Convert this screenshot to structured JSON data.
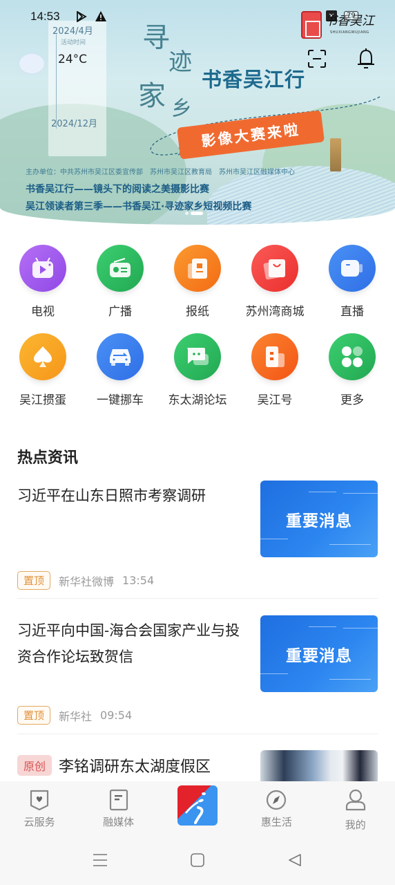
{
  "status_bar": {
    "time": "14:53",
    "icons": [
      "play-store-icon",
      "warning-icon"
    ],
    "battery": "79",
    "notification_badge": "×"
  },
  "banner": {
    "date_start": "2024/4月",
    "date_label": "活动时间",
    "temperature": "24°C",
    "date_end": "2024/12月",
    "calligraphy": [
      "寻",
      "迹",
      "家",
      "乡"
    ],
    "title": "书香吴江行",
    "tag": "影像大赛来啦",
    "organizer": "主办单位：中共苏州市吴江区委宣传部　苏州市吴江区教育局　苏州市吴江区融媒体中心",
    "subtitle_1": "书香吴江行——镜头下的阅读之美摄影比赛",
    "subtitle_2": "吴江领读者第三季——书香吴江·寻迹家乡短视频比赛",
    "logo_text": "书香吴江",
    "logo_sub": "SHUXIANGWUJIANG",
    "carousel_pages": 2,
    "carousel_active": 1
  },
  "grid": {
    "items": [
      {
        "label": "电视",
        "icon": "tv-icon",
        "color": "#a55ef0"
      },
      {
        "label": "广播",
        "icon": "radio-icon",
        "color": "#2fbb5f"
      },
      {
        "label": "报纸",
        "icon": "newspaper-icon",
        "color": "#f7821f"
      },
      {
        "label": "苏州湾商城",
        "icon": "shopping-bag-icon",
        "color": "#f2413f"
      },
      {
        "label": "直播",
        "icon": "video-camera-icon",
        "color": "#3a7ff0"
      },
      {
        "label": "吴江掼蛋",
        "icon": "spade-icon",
        "color": "#f9a51f"
      },
      {
        "label": "一键挪车",
        "icon": "car-icon",
        "color": "#3a7ff0"
      },
      {
        "label": "东太湖论坛",
        "icon": "chat-icon",
        "color": "#2fbb5f"
      },
      {
        "label": "吴江号",
        "icon": "building-icon",
        "color": "#f7621f"
      },
      {
        "label": "更多",
        "icon": "more-grid-icon",
        "color": "#2fbb5f"
      }
    ]
  },
  "news": {
    "section_title": "热点资讯",
    "items": [
      {
        "title": "习近平在山东日照市考察调研",
        "thumb_text": "重要消息",
        "tag": "置顶",
        "source": "新华社微博",
        "time": "13:54"
      },
      {
        "title": "习近平向中国-海合会国家产业与投资合作论坛致贺信",
        "thumb_text": "重要消息",
        "tag": "置顶",
        "source": "新华社",
        "time": "09:54"
      },
      {
        "title": "李铭调研东太湖度假区",
        "tag": "原创"
      }
    ]
  },
  "bottom_nav": {
    "items": [
      {
        "label": "云服务",
        "icon": "shield-heart-icon"
      },
      {
        "label": "融媒体",
        "icon": "document-icon"
      },
      {
        "label": "",
        "icon": "app-logo-icon"
      },
      {
        "label": "惠生活",
        "icon": "compass-icon"
      },
      {
        "label": "我的",
        "icon": "user-icon"
      }
    ]
  },
  "system_nav": {
    "menu": "☰",
    "home": "▢",
    "back": "◁"
  }
}
